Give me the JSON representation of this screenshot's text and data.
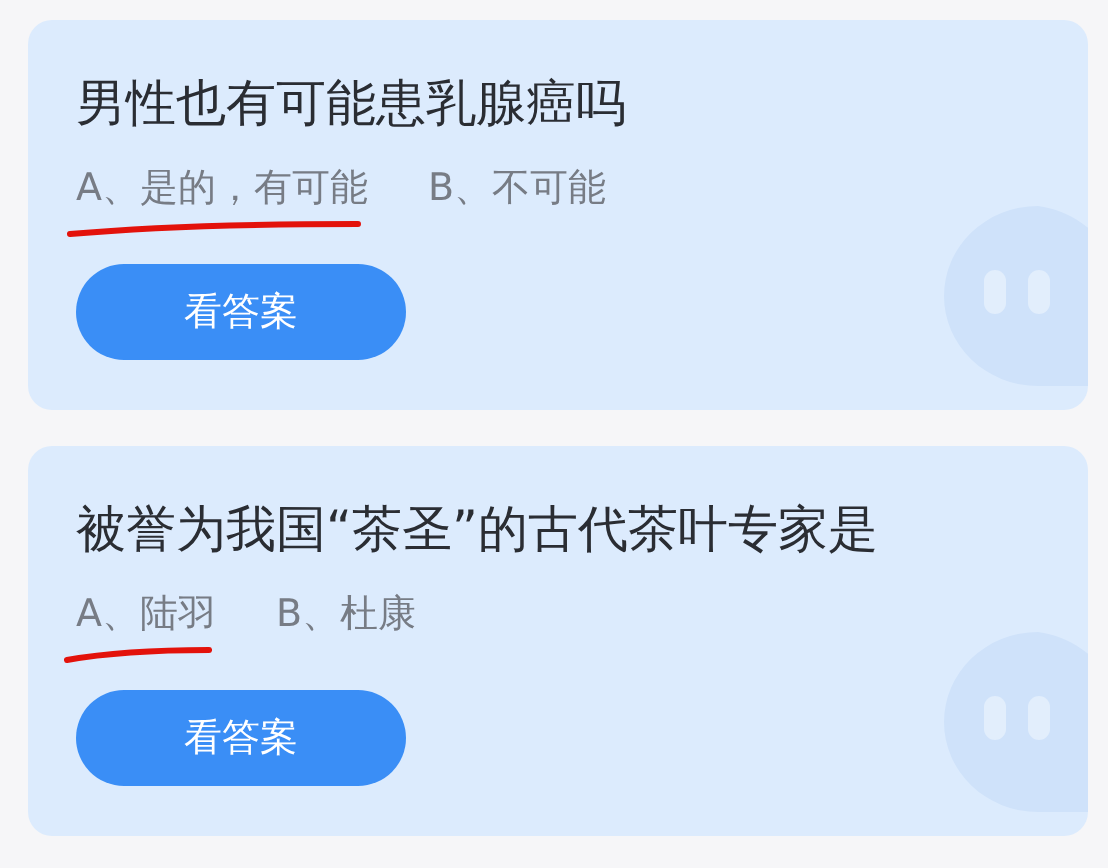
{
  "questions": [
    {
      "title": "男性也有可能患乳腺癌吗",
      "options": [
        {
          "text": "A、是的，有可能",
          "underlined": true
        },
        {
          "text": "B、不可能",
          "underlined": false
        }
      ],
      "button": "看答案"
    },
    {
      "title": "被誉为我国“茶圣”的古代茶叶专家是",
      "options": [
        {
          "text": "A、陆羽",
          "underlined": true
        },
        {
          "text": "B、杜康",
          "underlined": false
        }
      ],
      "button": "看答案"
    }
  ]
}
